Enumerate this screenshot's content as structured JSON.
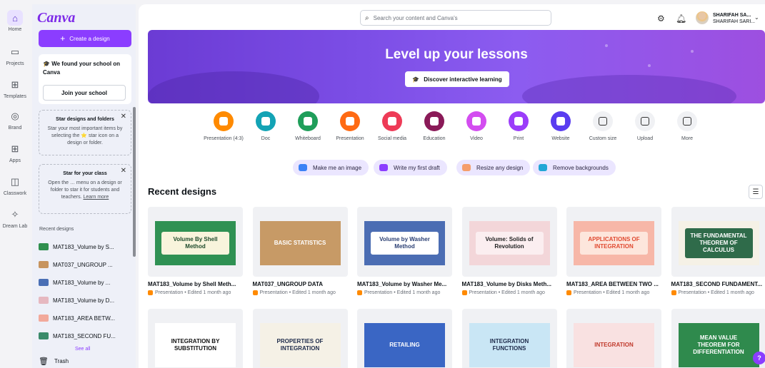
{
  "rail": [
    {
      "label": "Home",
      "icon": "home-icon",
      "active": true
    },
    {
      "label": "Projects",
      "icon": "folder-icon"
    },
    {
      "label": "Templates",
      "icon": "templates-icon"
    },
    {
      "label": "Brand",
      "icon": "brand-icon"
    },
    {
      "label": "Apps",
      "icon": "apps-icon"
    },
    {
      "label": "Classwork",
      "icon": "classwork-icon"
    },
    {
      "label": "Dream Lab",
      "icon": "dream-lab-icon"
    }
  ],
  "panel": {
    "logo": "Canva",
    "create_label": "Create a design",
    "school_title": "We found your school on Canva",
    "school_button": "Join your school",
    "tip1": {
      "title": "Star designs and folders",
      "body": "Star your most important items by selecting the ⭐ star icon on a design or folder."
    },
    "tip2": {
      "title": "Star for your class",
      "body": "Open the … menu on a design or folder to star it for students and teachers.",
      "link": "Learn more"
    },
    "recent_title": "Recent designs",
    "recent": [
      {
        "label": "MAT183_Volume by S...",
        "color": "#2f8f4e"
      },
      {
        "label": "MAT037_UNGROUP ...",
        "color": "#c7945e"
      },
      {
        "label": "MAT183_Volume by ...",
        "color": "#4a6fb5"
      },
      {
        "label": "MAT183_Volume by D...",
        "color": "#e6b8c0"
      },
      {
        "label": "MAT183_AREA BETW...",
        "color": "#f2a99b"
      },
      {
        "label": "MAT183_SECOND FU...",
        "color": "#3a8a6a"
      }
    ],
    "see_all": "See all",
    "trash": "Trash"
  },
  "header": {
    "search_placeholder": "Search your content and Canva's",
    "user_name": "SHARIFAH SA...",
    "user_sub": "SHARIFAH SARI..."
  },
  "banner": {
    "title": "Level up your lessons",
    "button": "Discover interactive learning"
  },
  "categories": [
    {
      "label": "Presentation (4:3)",
      "color": "#ff8a00"
    },
    {
      "label": "Doc",
      "color": "#13a3b5"
    },
    {
      "label": "Whiteboard",
      "color": "#1f9e5a"
    },
    {
      "label": "Presentation",
      "color": "#ff6a13"
    },
    {
      "label": "Social media",
      "color": "#ee3b57"
    },
    {
      "label": "Education",
      "color": "#8a1a58"
    },
    {
      "label": "Video",
      "color": "#d34df0"
    },
    {
      "label": "Print",
      "color": "#9b3dfa"
    },
    {
      "label": "Website",
      "color": "#5a3df0"
    },
    {
      "label": "Custom size",
      "color": "#f0f1f4",
      "outline": true
    },
    {
      "label": "Upload",
      "color": "#f0f1f4",
      "outline": true
    },
    {
      "label": "More",
      "color": "#f0f1f4",
      "outline": true
    }
  ],
  "chips": [
    {
      "label": "Make me an image",
      "color": "#3b82f6"
    },
    {
      "label": "Write my first draft",
      "color": "#8b3dff"
    },
    {
      "label": "Resize any design",
      "color": "#f59e6b"
    },
    {
      "label": "Remove backgrounds",
      "color": "#22a6d6"
    }
  ],
  "recent_section": {
    "title": "Recent designs"
  },
  "designs": [
    {
      "name": "MAT183_Volume by Shell Meth...",
      "meta": "Presentation • Edited 1 month ago",
      "slide_text": "Volume By Shell Method",
      "bg": "#2f9153",
      "fg": "#1d4a2b",
      "inner": "#f8f4dc"
    },
    {
      "name": "MAT037_UNGROUP DATA",
      "meta": "Presentation • Edited 1 month ago",
      "slide_text": "BASIC STATISTICS",
      "bg": "#c79a66",
      "fg": "#ffffff",
      "inner": "#c79a66"
    },
    {
      "name": "MAT183_Volume by Washer Me...",
      "meta": "Presentation • Edited 1 month ago",
      "slide_text": "Volume by Washer Method",
      "bg": "#4b6db3",
      "fg": "#2a3f73",
      "inner": "#ffffff"
    },
    {
      "name": "MAT183_Volume by Disks Meth...",
      "meta": "Presentation • Edited 1 month ago",
      "slide_text": "Volume: Solids of Revolution",
      "bg": "#f3d6d9",
      "fg": "#222222",
      "inner": "#fbeef0"
    },
    {
      "name": "MAT183_AREA BETWEEN TWO ...",
      "meta": "Presentation • Edited 1 month ago",
      "slide_text": "APPLICATIONS OF INTEGRATION",
      "bg": "#f7b7a8",
      "fg": "#e0492f",
      "inner": "#fde6dc"
    },
    {
      "name": "MAT183_SECOND FUNDAMENT...",
      "meta": "Presentation • Edited 1 month ago",
      "slide_text": "THE FUNDAMENTAL THEOREM OF CALCULUS",
      "bg": "#f5f1e6",
      "fg": "#ffffff",
      "inner": "#2f6b4a"
    },
    {
      "name": "",
      "meta": "",
      "slide_text": "INTEGRATION BY SUBSTITUTION",
      "bg": "#ffffff",
      "fg": "#111111",
      "inner": "#ffffff"
    },
    {
      "name": "",
      "meta": "",
      "slide_text": "PROPERTIES OF INTEGRATION",
      "bg": "#f5f1e6",
      "fg": "#1d2a4a",
      "inner": "#f5f1e6"
    },
    {
      "name": "",
      "meta": "",
      "slide_text": "RETAILING",
      "bg": "#3a66c4",
      "fg": "#ffffff",
      "inner": "#3a66c4"
    },
    {
      "name": "",
      "meta": "",
      "slide_text": "INTEGRATION FUNCTIONS",
      "bg": "#c9e6f5",
      "fg": "#1d2a4a",
      "inner": "#c9e6f5"
    },
    {
      "name": "",
      "meta": "",
      "slide_text": "INTEGRATION",
      "bg": "#f9e1e1",
      "fg": "#c0392b",
      "inner": "#f9e1e1"
    },
    {
      "name": "",
      "meta": "",
      "slide_text": "MEAN VALUE THEOREM FOR DIFFERENTIATION",
      "bg": "#2f8a4d",
      "fg": "#ffffff",
      "inner": "#2f8a4d"
    }
  ]
}
